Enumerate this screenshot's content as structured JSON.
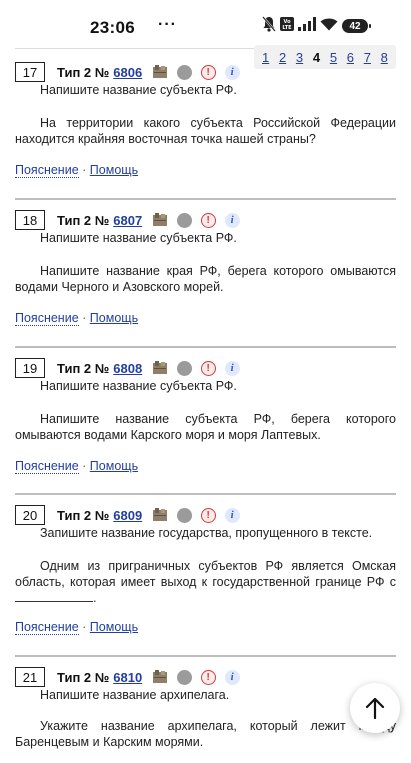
{
  "status": {
    "time": "23:06",
    "dots": "···",
    "battery": "42",
    "icons": [
      "bell-off-icon",
      "volte-icon",
      "signal-icon",
      "wifi-icon",
      "battery-icon"
    ]
  },
  "pager": {
    "pages": [
      "1",
      "2",
      "3",
      "4",
      "5",
      "6",
      "7",
      "8"
    ],
    "current": "4"
  },
  "tasks": [
    {
      "num": "17",
      "type": "Тип 2 №",
      "id": "6806",
      "instruction": "Напишите название субъекта РФ.",
      "question": "На территории какого субъекта Российской Федерации находится крайняя восточная точка нашей страны?",
      "explain": "Пояснение",
      "sep": "·",
      "help": "Помощь"
    },
    {
      "num": "18",
      "type": "Тип 2 №",
      "id": "6807",
      "instruction": "Напишите название субъекта РФ.",
      "question": "Напишите название края РФ, берега которого омываются водами Черного и Азовского морей.",
      "explain": "Пояснение",
      "sep": "·",
      "help": "Помощь"
    },
    {
      "num": "19",
      "type": "Тип 2 №",
      "id": "6808",
      "instruction": "Напишите название субъекта РФ.",
      "question": "Напишите название субъекта РФ, берега которого омываются водами Карского моря и моря Лаптевых.",
      "explain": "Пояснение",
      "sep": "·",
      "help": "Помощь"
    },
    {
      "num": "20",
      "type": "Тип 2 №",
      "id": "6809",
      "instruction": "Запишите название государства, пропущенного в тексте.",
      "question": "Одним из приграничных субъектов РФ является Омская область, которая имеет выход к государственной границе РФ с",
      "question_end": ".",
      "explain": "Пояснение",
      "sep": "·",
      "help": "Помощь"
    },
    {
      "num": "21",
      "type": "Тип 2 №",
      "id": "6810",
      "instruction": "Напишите название архипелага.",
      "question": "Укажите название архипелага, который лежит между Баренцевым и Карским морями."
    }
  ],
  "fab": {
    "icon": "arrow-up-icon"
  }
}
